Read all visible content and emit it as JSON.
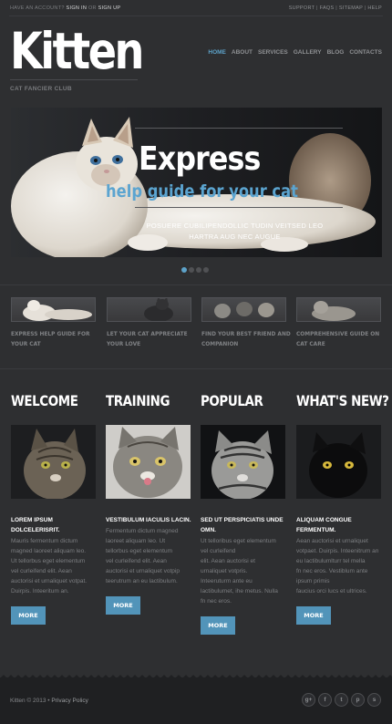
{
  "topbar": {
    "prefix": "HAVE AN ACCOUNT?",
    "sign_in": "SIGN IN",
    "or": "OR",
    "sign_up": "SIGN UP",
    "links": [
      "SUPPORT",
      "FAQS",
      "SITEMAP",
      "HELP"
    ]
  },
  "header": {
    "logo": "Kitten",
    "tagline": "CAT FANCIER CLUB"
  },
  "nav": {
    "items": [
      {
        "label": "HOME",
        "active": true
      },
      {
        "label": "ABOUT",
        "active": false
      },
      {
        "label": "SERVICES",
        "active": false
      },
      {
        "label": "GALLERY",
        "active": false
      },
      {
        "label": "BLOG",
        "active": false
      },
      {
        "label": "CONTACTS",
        "active": false
      }
    ]
  },
  "slider": {
    "title": "Express",
    "subtitle": "help guide for your cat",
    "text_line1": "POSUERE CUBILIPENDOLLIC TUDIN VEITSED LEO",
    "text_line2": "HARTRA AUG NEC AUGUE",
    "slide_count": 4,
    "active_slide": 1
  },
  "thumbnails": [
    {
      "line1": "EXPRESS HELP GUIDE FOR",
      "line2": "YOUR CAT"
    },
    {
      "line1": "LET YOUR CAT APPRECIATE",
      "line2": "YOUR LOVE"
    },
    {
      "line1": "FIND YOUR BEST FRIEND AND",
      "line2": "COMPANION"
    },
    {
      "line1": "COMPREHENSIVE GUIDE ON",
      "line2": "CAT CARE"
    }
  ],
  "columns": [
    {
      "heading": "WELCOME",
      "title": "LOREM IPSUM DOLCELERISRIT.",
      "text": [
        "Mauris fermentum dictum",
        "magned laoreet aliquam leo.",
        "Ut tellorbus eget elementum",
        "vel curleifend elit. Aean",
        "auctorisi et urnaliquet votpat.",
        "Duirpis. Inteeritum an."
      ],
      "button": "MORE"
    },
    {
      "heading": "TRAINING",
      "title": "VESTIBULUM IACULIS LACIN.",
      "text": [
        "Fermentum dictum magned",
        "laoreet aliquam leo. Ut",
        "tellorbus eget elementum",
        "vel curleifend elit. Aean",
        "auctorisi et urnaliquet votpip",
        "teerutrum an eu lactibulum."
      ],
      "button": "MORE"
    },
    {
      "heading": "POPULAR",
      "title": "SED UT PERSPICIATIS UNDE OMN.",
      "text": [
        "Ut telloribus eget elementum",
        "vel curleifend",
        "elit. Aean auctorisi et",
        "urnaliquet votpris.",
        "Inteeruturm ante eu",
        "lactibulumet, ihe metus. Nulla",
        "fn nec eros."
      ],
      "button": "MORE"
    },
    {
      "heading": "WHAT'S NEW?",
      "title": "ALIQUAM CONGUE FERMENTUM.",
      "text": [
        "Aean auctorisi et urnaliquet",
        "votpaet. Duirpis. Inteenitrum an",
        "eu lactibulumlturr tel mella",
        "fn nec eros. Vestiblum ante",
        "ipsum primis",
        "faucius orci lucs et ultrices."
      ],
      "button": "MORE"
    }
  ],
  "footer": {
    "copyright": "Kitten © 2013 •",
    "privacy": "Privacy Policy",
    "social": [
      {
        "icon": "google-plus-icon",
        "glyph": "g+"
      },
      {
        "icon": "facebook-icon",
        "glyph": "f"
      },
      {
        "icon": "twitter-icon",
        "glyph": "t"
      },
      {
        "icon": "pinterest-icon",
        "glyph": "p"
      },
      {
        "icon": "skype-icon",
        "glyph": "s"
      }
    ]
  },
  "colors": {
    "background": "#2e2f31",
    "accent": "#5da2c9",
    "button": "#5294b9",
    "footer": "#1f2022"
  }
}
